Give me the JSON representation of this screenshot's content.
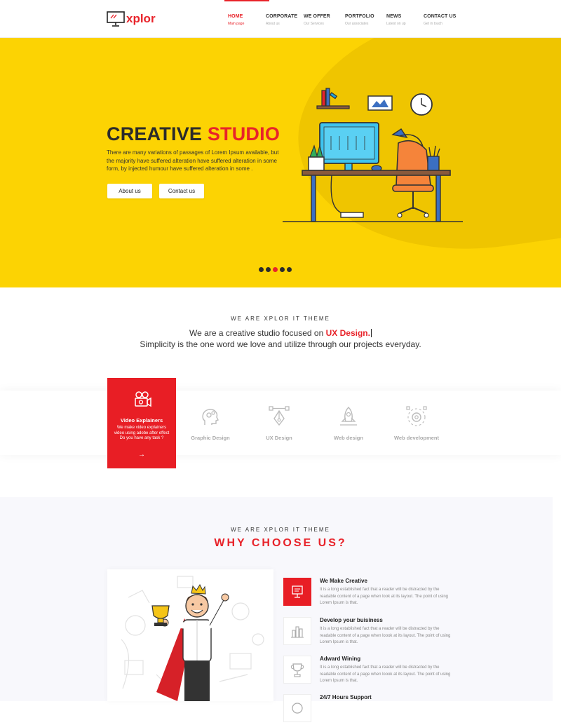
{
  "brand": {
    "name": "xplor",
    "accent": "#e8232a",
    "hero_bg": "#fcd303"
  },
  "nav": [
    {
      "label": "HOME",
      "sub": "Main page",
      "active": true
    },
    {
      "label": "CORPORATE",
      "sub": "About us"
    },
    {
      "label": "WE OFFER",
      "sub": "Our Services"
    },
    {
      "label": "PORTFOLIO",
      "sub": "Our associates"
    },
    {
      "label": "NEWS",
      "sub": "Latest on up"
    },
    {
      "label": "CONTACT US",
      "sub": "Get in touch"
    }
  ],
  "hero": {
    "title_a": "CREATIVE",
    "title_b": "STUDIO",
    "desc": "There are many variations of passages of Lorem Ipsum available, but the majority have suffered alteration have suffered alteration in some form, by injected humour have suffered alteration in some .",
    "btn_about": "About us",
    "btn_contact": "Contact us",
    "slides": 5,
    "active_slide": 3
  },
  "about": {
    "kicker": "WE ARE XPLOR IT THEME",
    "line1_pre": "We are a creative studio focused on ",
    "line1_hl": "UX Design.",
    "line2": "Simplicity is the one word we love and utilize through our projects everyday."
  },
  "services": {
    "featured": {
      "title": "Video Explainers",
      "desc_1": "We make video explainers",
      "desc_2": "video using adobe after effect",
      "desc_3": "Do you have any task ?",
      "arrow": "→",
      "icon": "video-camera-icon"
    },
    "items": [
      {
        "label": "Graphic Design",
        "icon": "head-gears-icon"
      },
      {
        "label": "UX Design",
        "icon": "pen-tool-icon"
      },
      {
        "label": "Web design",
        "icon": "rocket-icon"
      },
      {
        "label": "Web development",
        "icon": "gear-nodes-icon"
      }
    ]
  },
  "why": {
    "kicker": "WE ARE XPLOR IT THEME",
    "title": "WHY CHOOSE US?",
    "features": [
      {
        "title": "We Make Creative",
        "desc": "It is a long established fact that a reader will be distracted by the readable content of a page when look at its layout. The point of using Lorem Ipsum is that.",
        "icon": "monitor-icon",
        "highlight": true
      },
      {
        "title": "Develop your buisiness",
        "desc": "It is a long established fact that a reader will be distracted by the readable content of a page when loook at its layout. The point of using Lorem Ipsum is that.",
        "icon": "bar-chart-icon"
      },
      {
        "title": "Adward Wining",
        "desc": "It is a long established fact that a reader will be distracted by the readable content of a page when loook at its layout. The point of using Lorem Ipsum is that.",
        "icon": "trophy-icon"
      },
      {
        "title": "24/7 Hours Support",
        "desc": "",
        "icon": "support-icon"
      }
    ]
  }
}
